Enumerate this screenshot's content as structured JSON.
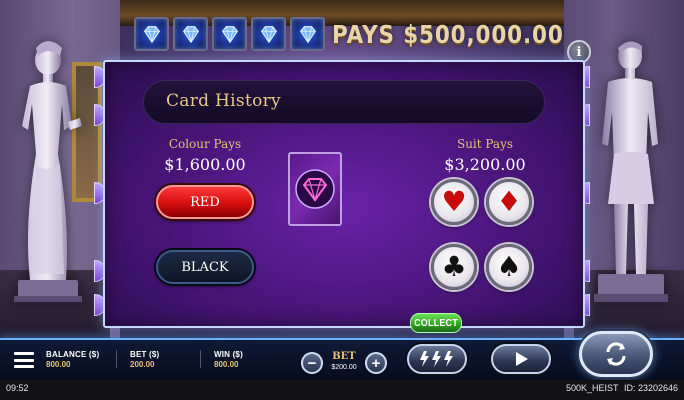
{
  "jackpot": {
    "text": "PAYS $500,000.00",
    "gem_count": 5
  },
  "info_button": {
    "label": "i"
  },
  "panel": {
    "title": "Card History",
    "colour_pays": {
      "label": "Colour Pays",
      "amount": "$1,600.00"
    },
    "suit_pays": {
      "label": "Suit Pays",
      "amount": "$3,200.00"
    },
    "red_button": "RED",
    "black_button": "BLACK",
    "suits": [
      {
        "name": "heart",
        "glyph": "♥",
        "color": "red"
      },
      {
        "name": "diamond",
        "glyph": "♦",
        "color": "red"
      },
      {
        "name": "club",
        "glyph": "♣",
        "color": "black"
      },
      {
        "name": "spade",
        "glyph": "♠",
        "color": "black"
      }
    ]
  },
  "collect_button": "COLLECT",
  "controls": {
    "balance": {
      "label": "BALANCE ($)",
      "value": "800.00"
    },
    "bet_stat": {
      "label": "BET ($)",
      "value": "200.00"
    },
    "win": {
      "label": "WIN ($)",
      "value": "800.00"
    },
    "bet_selector": {
      "label": "BET",
      "value": "$200.00",
      "minus": "−",
      "plus": "+"
    }
  },
  "status": {
    "time": "09:52",
    "game_name": "500K_HEIST",
    "game_id": "ID: 23202646"
  },
  "colors": {
    "panel_border": "#c8d8ff",
    "gold_text": "#e6c27a",
    "red_button": "#d40d0d",
    "collect_green": "#2ea01e",
    "bar_glow": "#6ab0ff"
  }
}
